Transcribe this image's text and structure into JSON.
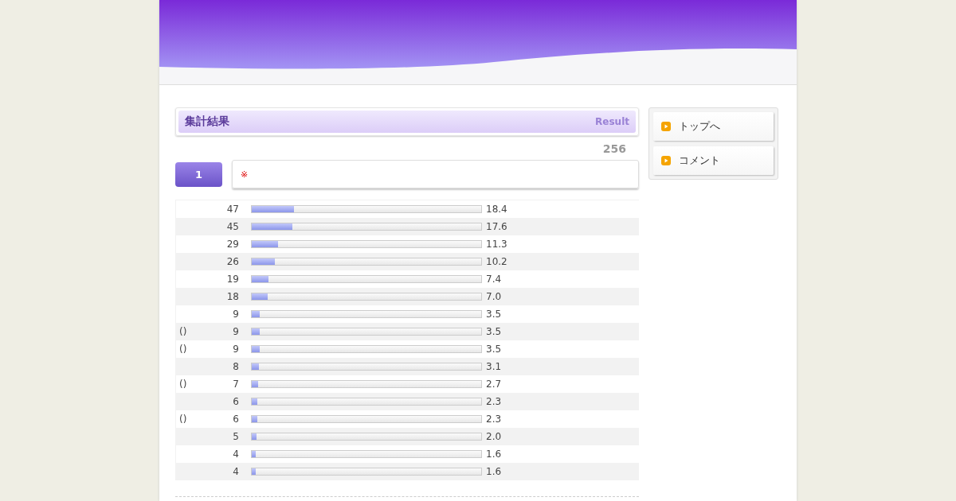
{
  "section": {
    "title": "集計結果",
    "subtitle": "Result"
  },
  "total": "256",
  "question": {
    "number": "1",
    "mark": "※"
  },
  "rows": [
    {
      "label": "",
      "count": "47",
      "level": 0.184,
      "percent": "18.4"
    },
    {
      "label": "",
      "count": "45",
      "level": 0.176,
      "percent": "17.6"
    },
    {
      "label": "",
      "count": "29",
      "level": 0.113,
      "percent": "11.3"
    },
    {
      "label": "",
      "count": "26",
      "level": 0.102,
      "percent": "10.2"
    },
    {
      "label": "",
      "count": "19",
      "level": 0.074,
      "percent": "7.4"
    },
    {
      "label": "",
      "count": "18",
      "level": 0.07,
      "percent": "7.0"
    },
    {
      "label": "",
      "count": "9",
      "level": 0.035,
      "percent": "3.5"
    },
    {
      "label": "()",
      "count": "9",
      "level": 0.035,
      "percent": "3.5"
    },
    {
      "label": "()",
      "count": "9",
      "level": 0.035,
      "percent": "3.5"
    },
    {
      "label": "",
      "count": "8",
      "level": 0.031,
      "percent": "3.1"
    },
    {
      "label": "()",
      "count": "7",
      "level": 0.027,
      "percent": "2.7"
    },
    {
      "label": "",
      "count": "6",
      "level": 0.023,
      "percent": "2.3"
    },
    {
      "label": "()",
      "count": "6",
      "level": 0.023,
      "percent": "2.3"
    },
    {
      "label": "",
      "count": "5",
      "level": 0.02,
      "percent": "2.0"
    },
    {
      "label": "",
      "count": "4",
      "level": 0.016,
      "percent": "1.6"
    },
    {
      "label": "",
      "count": "4",
      "level": 0.016,
      "percent": "1.6"
    }
  ],
  "sidebar": {
    "links": [
      "トップへ",
      "コメント"
    ]
  }
}
